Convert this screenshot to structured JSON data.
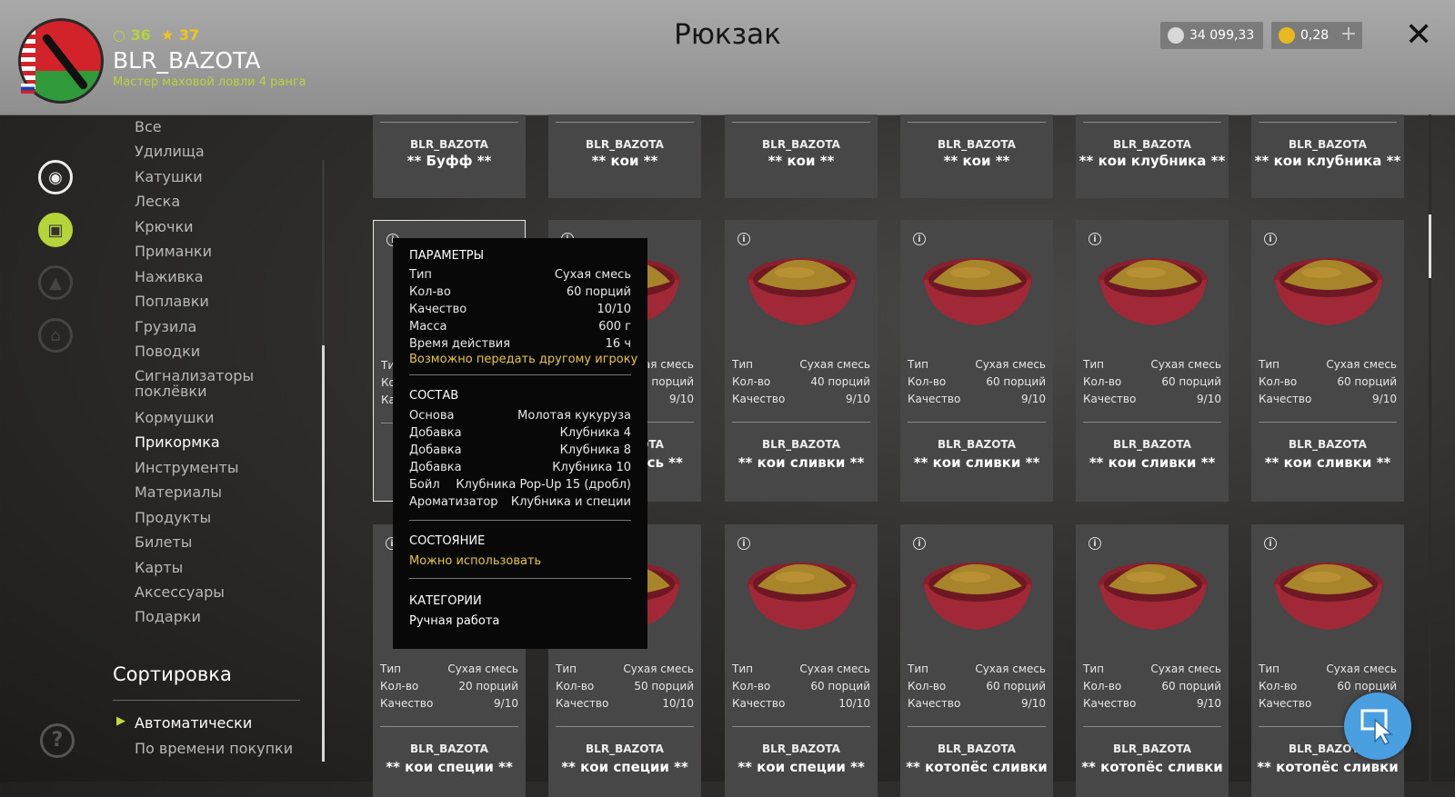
{
  "header": {
    "title": "Рюкзак",
    "level": "36",
    "stars": "37",
    "username": "BLR_BAZOTA",
    "rank": "Мастер маховой ловли 4 ранга",
    "silver": "34 099,33",
    "gold": "0,28",
    "plus": "+",
    "close": "✕"
  },
  "categories": [
    "Все",
    "Удилища",
    "Катушки",
    "Леска",
    "Крючки",
    "Приманки",
    "Наживка",
    "Поплавки",
    "Грузила",
    "Поводки",
    "Сигнализаторы поклёвки",
    "Кормушки",
    "Прикормка",
    "Инструменты",
    "Материалы",
    "Продукты",
    "Билеты",
    "Карты",
    "Аксессуары",
    "Подарки"
  ],
  "active_category": "Прикормка",
  "sort": {
    "title": "Сортировка",
    "options": [
      "Автоматически",
      "По времени покупки"
    ]
  },
  "labels": {
    "type": "Тип",
    "qty": "Кол-во",
    "quality": "Качество"
  },
  "top_row": [
    {
      "owner": "BLR_BAZOTA",
      "name": "** Буфф **"
    },
    {
      "owner": "BLR_BAZOTA",
      "name": "** кои **"
    },
    {
      "owner": "BLR_BAZOTA",
      "name": "** кои **"
    },
    {
      "owner": "BLR_BAZOTA",
      "name": "** кои **"
    },
    {
      "owner": "BLR_BAZOTA",
      "name": "** кои клубника **"
    },
    {
      "owner": "BLR_BAZOTA",
      "name": "** кои клубника **"
    }
  ],
  "row2": [
    {
      "type": "",
      "qty": "",
      "quality": "",
      "owner": "",
      "name": "**"
    },
    {
      "type": "Сухая смесь",
      "qty": "60 порций",
      "quality": "9/10",
      "owner": "BLR_BAZOTA",
      "name": "** кои смесь **"
    },
    {
      "type": "Сухая смесь",
      "qty": "40 порций",
      "quality": "9/10",
      "owner": "BLR_BAZOTA",
      "name": "** кои сливки **"
    },
    {
      "type": "Сухая смесь",
      "qty": "60 порций",
      "quality": "9/10",
      "owner": "BLR_BAZOTA",
      "name": "** кои сливки **"
    },
    {
      "type": "Сухая смесь",
      "qty": "60 порций",
      "quality": "9/10",
      "owner": "BLR_BAZOTA",
      "name": "** кои сливки **"
    },
    {
      "type": "Сухая смесь",
      "qty": "60 порций",
      "quality": "9/10",
      "owner": "BLR_BAZOTA",
      "name": "** кои сливки **"
    }
  ],
  "row3": [
    {
      "type": "Сухая смесь",
      "qty": "20 порций",
      "quality": "9/10",
      "owner": "BLR_BAZOTA",
      "name": "** кои специи **"
    },
    {
      "type": "Сухая смесь",
      "qty": "50 порций",
      "quality": "10/10",
      "owner": "BLR_BAZOTA",
      "name": "** кои специи **"
    },
    {
      "type": "Сухая смесь",
      "qty": "60 порций",
      "quality": "10/10",
      "owner": "BLR_BAZOTA",
      "name": "** кои специи **"
    },
    {
      "type": "Сухая смесь",
      "qty": "60 порций",
      "quality": "9/10",
      "owner": "BLR_BAZOTA",
      "name": "** котопёс сливки"
    },
    {
      "type": "Сухая смесь",
      "qty": "60 порций",
      "quality": "9/10",
      "owner": "BLR_BAZOTA",
      "name": "** котопёс сливки"
    },
    {
      "type": "Сухая смесь",
      "qty": "60 порций",
      "quality": "",
      "owner": "BLR_BAZOTA",
      "name": "** котопёс сливки"
    }
  ],
  "tooltip": {
    "params_title": "ПАРАМЕТРЫ",
    "params": [
      {
        "k": "Тип",
        "v": "Сухая смесь"
      },
      {
        "k": "Кол-во",
        "v": "60 порций"
      },
      {
        "k": "Качество",
        "v": "10/10"
      },
      {
        "k": "Масса",
        "v": "600 г"
      },
      {
        "k": "Время действия",
        "v": "16 ч"
      }
    ],
    "transfer": "Возможно передать другому игроку",
    "comp_title": "СОСТАВ",
    "composition": [
      {
        "k": "Основа",
        "v": "Молотая кукуруза"
      },
      {
        "k": "Добавка",
        "v": "Клубника 4"
      },
      {
        "k": "Добавка",
        "v": "Клубника 8"
      },
      {
        "k": "Добавка",
        "v": "Клубника 10"
      },
      {
        "k": "Бойл",
        "v": "Клубника Pop-Up 15 (дробл)"
      },
      {
        "k": "Ароматизатор",
        "v": "Клубника и специи"
      }
    ],
    "state_title": "СОСТОЯНИЕ",
    "state": "Можно использовать",
    "cat_title": "КАТЕГОРИИ",
    "category": "Ручная работа"
  },
  "colors": {
    "accent": "#b5d43a",
    "highlight": "#e8c53a",
    "bowl": "#9c2433",
    "mix": "#a8842a"
  }
}
